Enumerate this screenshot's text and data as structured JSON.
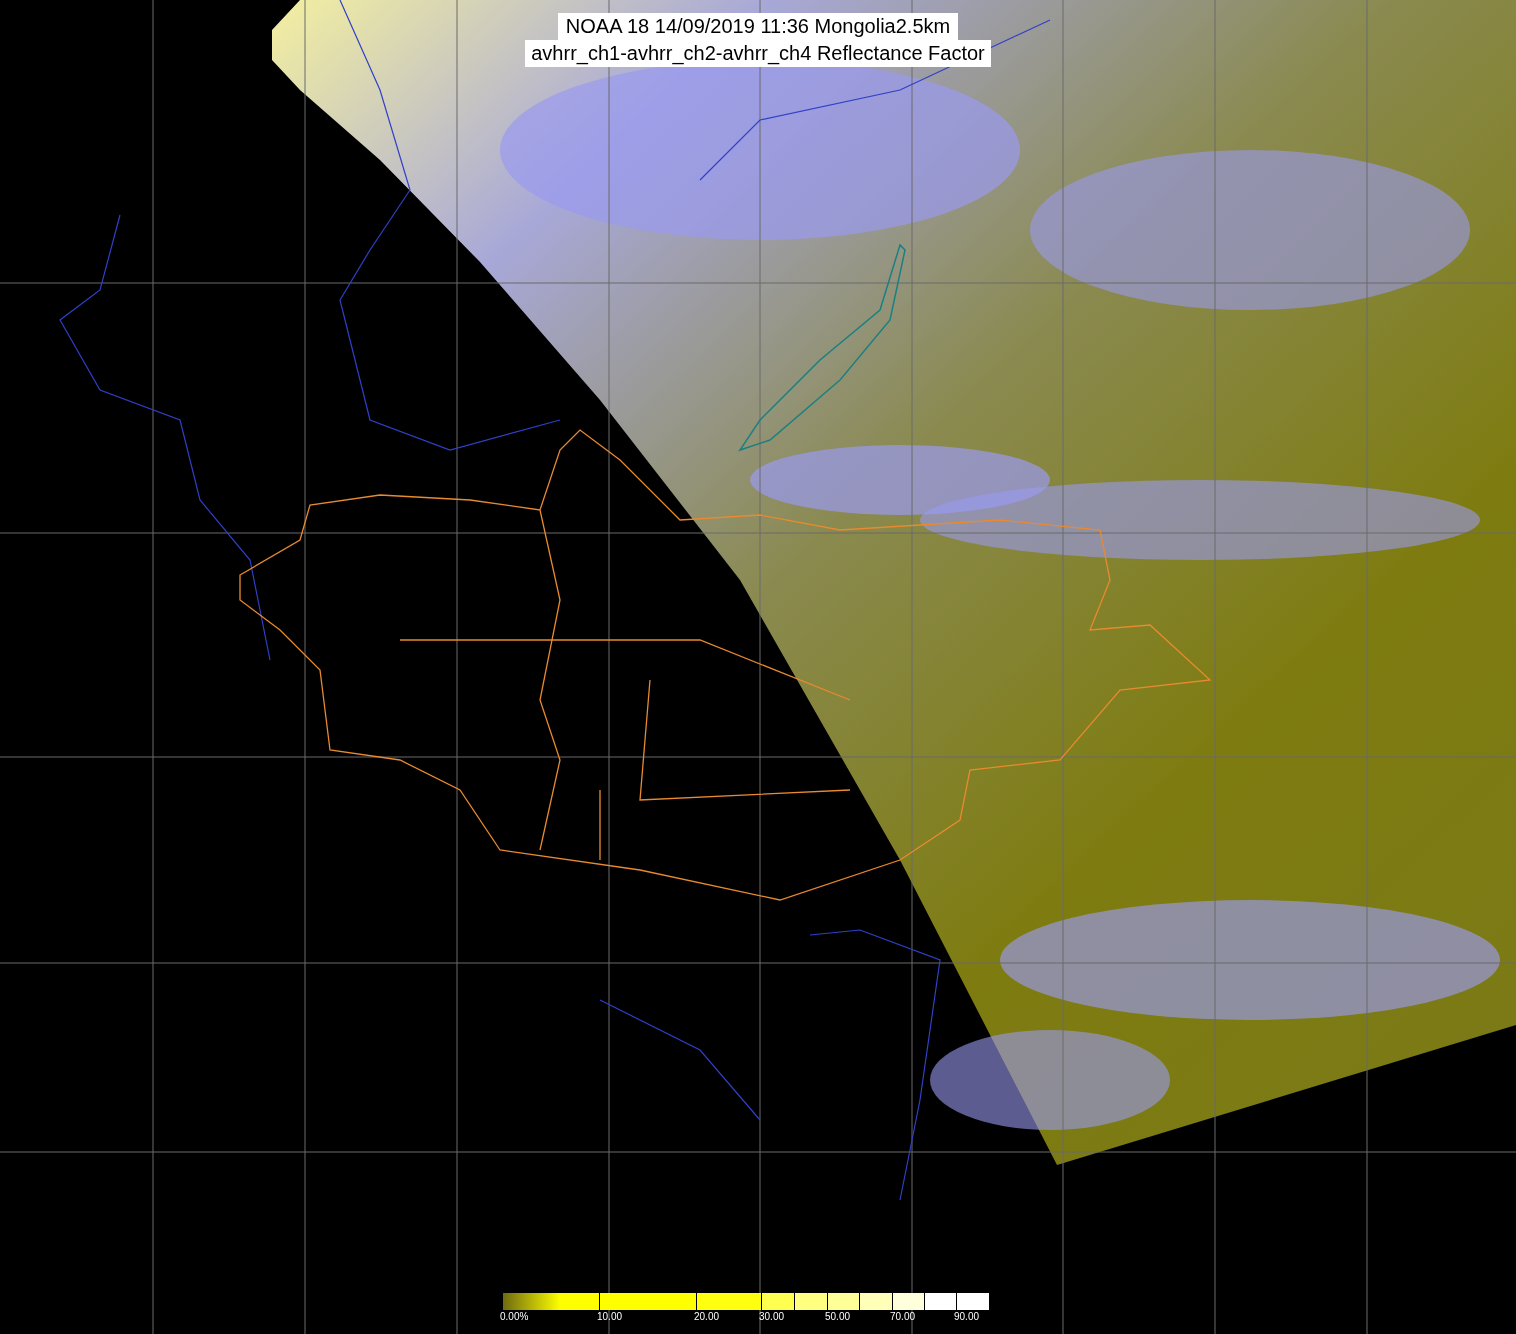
{
  "title": {
    "lines": [
      "NOAA 18 14/09/2019 11:36 Mongolia2.5km",
      "avhrr_ch1-avhrr_ch2-avhrr_ch4 Reflectance Factor"
    ]
  },
  "colorbar": {
    "tick_labels": [
      "0.00%",
      "10.00",
      "20.00",
      "30.00",
      "50.00",
      "70.00",
      "90.00"
    ]
  }
}
